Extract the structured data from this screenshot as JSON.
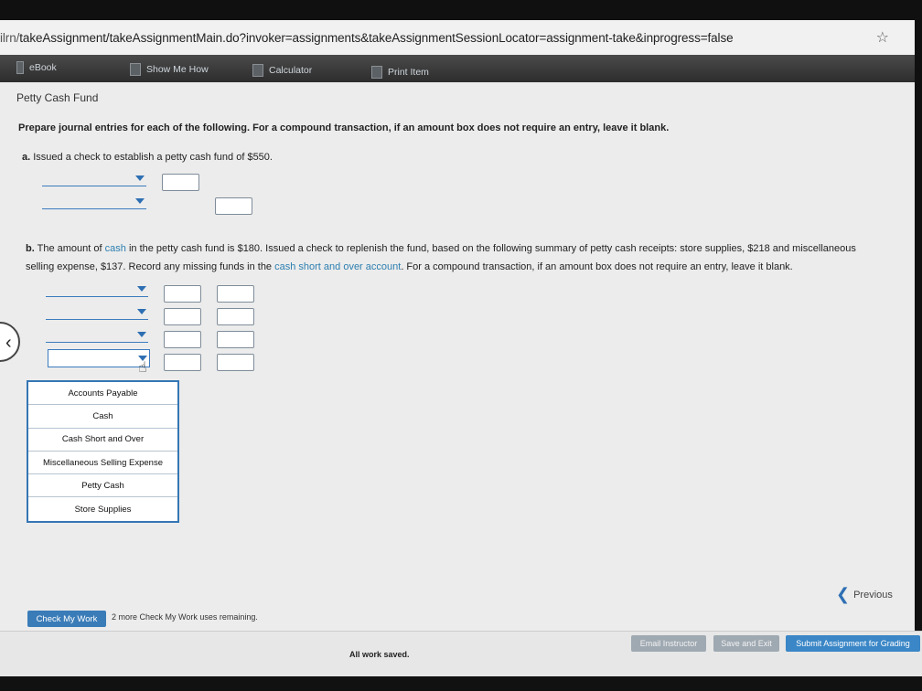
{
  "browser": {
    "url_host": "ilrn/",
    "url_path": "takeAssignment/takeAssignmentMain.do?invoker=assignments&takeAssignmentSessionLocator=assignment-take&inprogress=false"
  },
  "toolbar": {
    "ebook": "eBook",
    "show_me_how": "Show Me How",
    "calculator": "Calculator",
    "print_item": "Print Item"
  },
  "section_title": "Petty Cash Fund",
  "instructions": "Prepare journal entries for each of the following. For a compound transaction, if an amount box does not require an entry, leave it blank.",
  "part_a": {
    "label": "a.",
    "text": "Issued a check to establish a petty cash fund of $550."
  },
  "part_b": {
    "label": "b.",
    "text1_pre": "The amount of ",
    "text1_link": "cash",
    "text1_post": " in the petty cash fund is $180. Issued a check to replenish the fund, based on the following summary of petty cash receipts: store supplies, $218 and miscellaneous",
    "text2_pre": "selling expense, $137. Record any missing funds in the ",
    "text2_link": "cash short and over account",
    "text2_post": ". For a compound transaction, if an amount box does not require an entry, leave it blank."
  },
  "dropdown_options": [
    "Accounts Payable",
    "Cash",
    "Cash Short and Over",
    "Miscellaneous Selling Expense",
    "Petty Cash",
    "Store Supplies"
  ],
  "nav": {
    "previous": "Previous"
  },
  "check_my_work": {
    "button": "Check My Work",
    "note": "2 more Check My Work uses remaining."
  },
  "footer": {
    "status": "All work saved.",
    "email": "Email Instructor",
    "save_exit": "Save and Exit",
    "submit": "Submit Assignment for Grading"
  },
  "colors": {
    "accent": "#3a7cb8",
    "link": "#2d7fb0",
    "footer_button": "#9fa9b2"
  }
}
